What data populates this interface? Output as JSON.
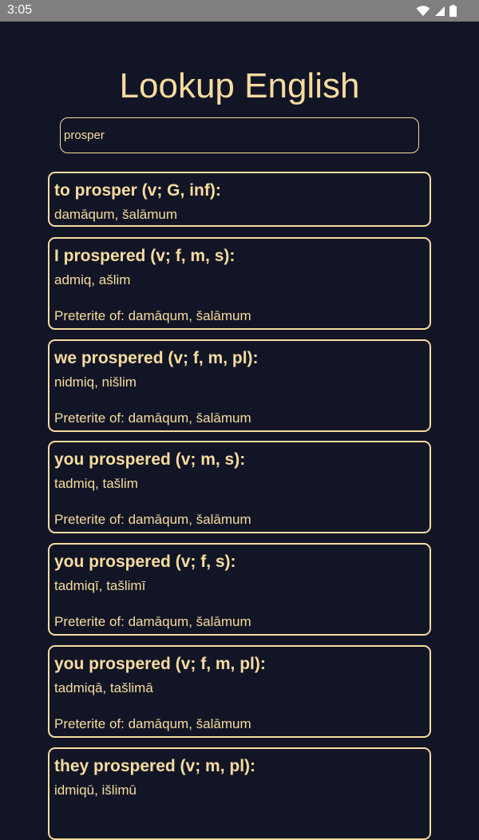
{
  "status_bar": {
    "time": "3:05",
    "icons": [
      "wifi-icon",
      "signal-icon",
      "battery-icon"
    ]
  },
  "app": {
    "title": "Lookup English"
  },
  "search": {
    "value": "prosper"
  },
  "results": [
    {
      "title": "to prosper (v; G, inf):",
      "forms": "damāqum, šalāmum",
      "note": ""
    },
    {
      "title": "I prospered (v; f, m, s):",
      "forms": "admiq, ašlim",
      "note": "Preterite of: damāqum, šalāmum"
    },
    {
      "title": "we prospered (v; f, m, pl):",
      "forms": "nidmiq, nišlim",
      "note": "Preterite of: damāqum, šalāmum"
    },
    {
      "title": "you prospered (v; m, s):",
      "forms": "tadmiq, tašlim",
      "note": "Preterite of: damāqum, šalāmum"
    },
    {
      "title": "you prospered (v; f, s):",
      "forms": "tadmiqī, tašlimī",
      "note": "Preterite of: damāqum, šalāmum"
    },
    {
      "title": "you prospered (v; f, m, pl):",
      "forms": "tadmiqā, tašlimā",
      "note": "Preterite of: damāqum, šalāmum"
    },
    {
      "title": "they prospered (v; m, pl):",
      "forms": "idmiqū, išlimū",
      "note": ""
    }
  ],
  "colors": {
    "background": "#121525",
    "accent": "#f7dca0",
    "status_bar": "#7f7f7f"
  }
}
